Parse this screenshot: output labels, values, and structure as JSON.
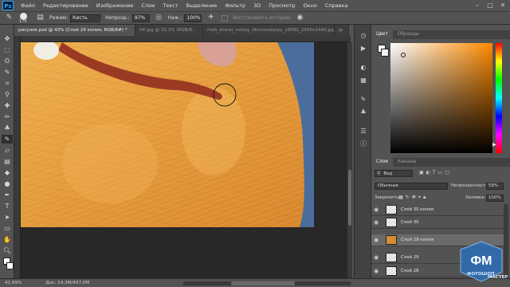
{
  "menubar": {
    "logo": "Ps",
    "items": [
      "Файл",
      "Редактирование",
      "Изображение",
      "Слои",
      "Текст",
      "Выделение",
      "Фильтр",
      "3D",
      "Просмотр",
      "Окно",
      "Справка"
    ],
    "min": "–",
    "max": "□",
    "close": "✕"
  },
  "options": {
    "brush_size": "175",
    "mode_label": "Режим:",
    "mode_value": "Кисть",
    "opacity_label": "Непрозр.:",
    "opacity_value": "97%",
    "flow_label": "Наж.:",
    "flow_value": "100%",
    "history_label": "Восстановить историю"
  },
  "tabs": [
    {
      "label": "рисунок.psd @ 43% (Слой 29 копия, RGB/8#) *",
      "active": true
    },
    {
      "label": "04.jpg @ 33,3% (RGB/8...",
      "active": false
    },
    {
      "label": "meh_sherst_volosy_dlinnovolosyy_18582_2560x1440.jpg",
      "active": false
    },
    {
      "label": "jp",
      "active": false
    }
  ],
  "status": {
    "zoom": "42,99%",
    "doc": "Док: 14,3M/497,0M"
  },
  "color_panel": {
    "tab_color": "Цвет",
    "tab_swatches": "Образцы"
  },
  "layers_panel": {
    "tab_layers": "Слои",
    "tab_channels": "Каналы",
    "kind_label": "Вид",
    "blend_mode": "Обычные",
    "opacity_label": "Непрозрачность:",
    "opacity_value": "59%",
    "lock_label": "Закрепить:",
    "fill_label": "Заливка:",
    "fill_value": "100%",
    "layers": [
      {
        "name": "Слой 30 копия",
        "selected": false
      },
      {
        "name": "Слой 30",
        "selected": false
      },
      {
        "name": "Слой 29 копия",
        "selected": true
      },
      {
        "name": "Слой 29",
        "selected": false
      },
      {
        "name": "Слой 28",
        "selected": false
      }
    ]
  },
  "watermark": {
    "text": "МАСТЕР",
    "sub": "ФОТОШОП"
  },
  "colors": {
    "accent": "#31a8ff",
    "fur": "#e8a040",
    "bg_blue": "#4a6d9c"
  }
}
